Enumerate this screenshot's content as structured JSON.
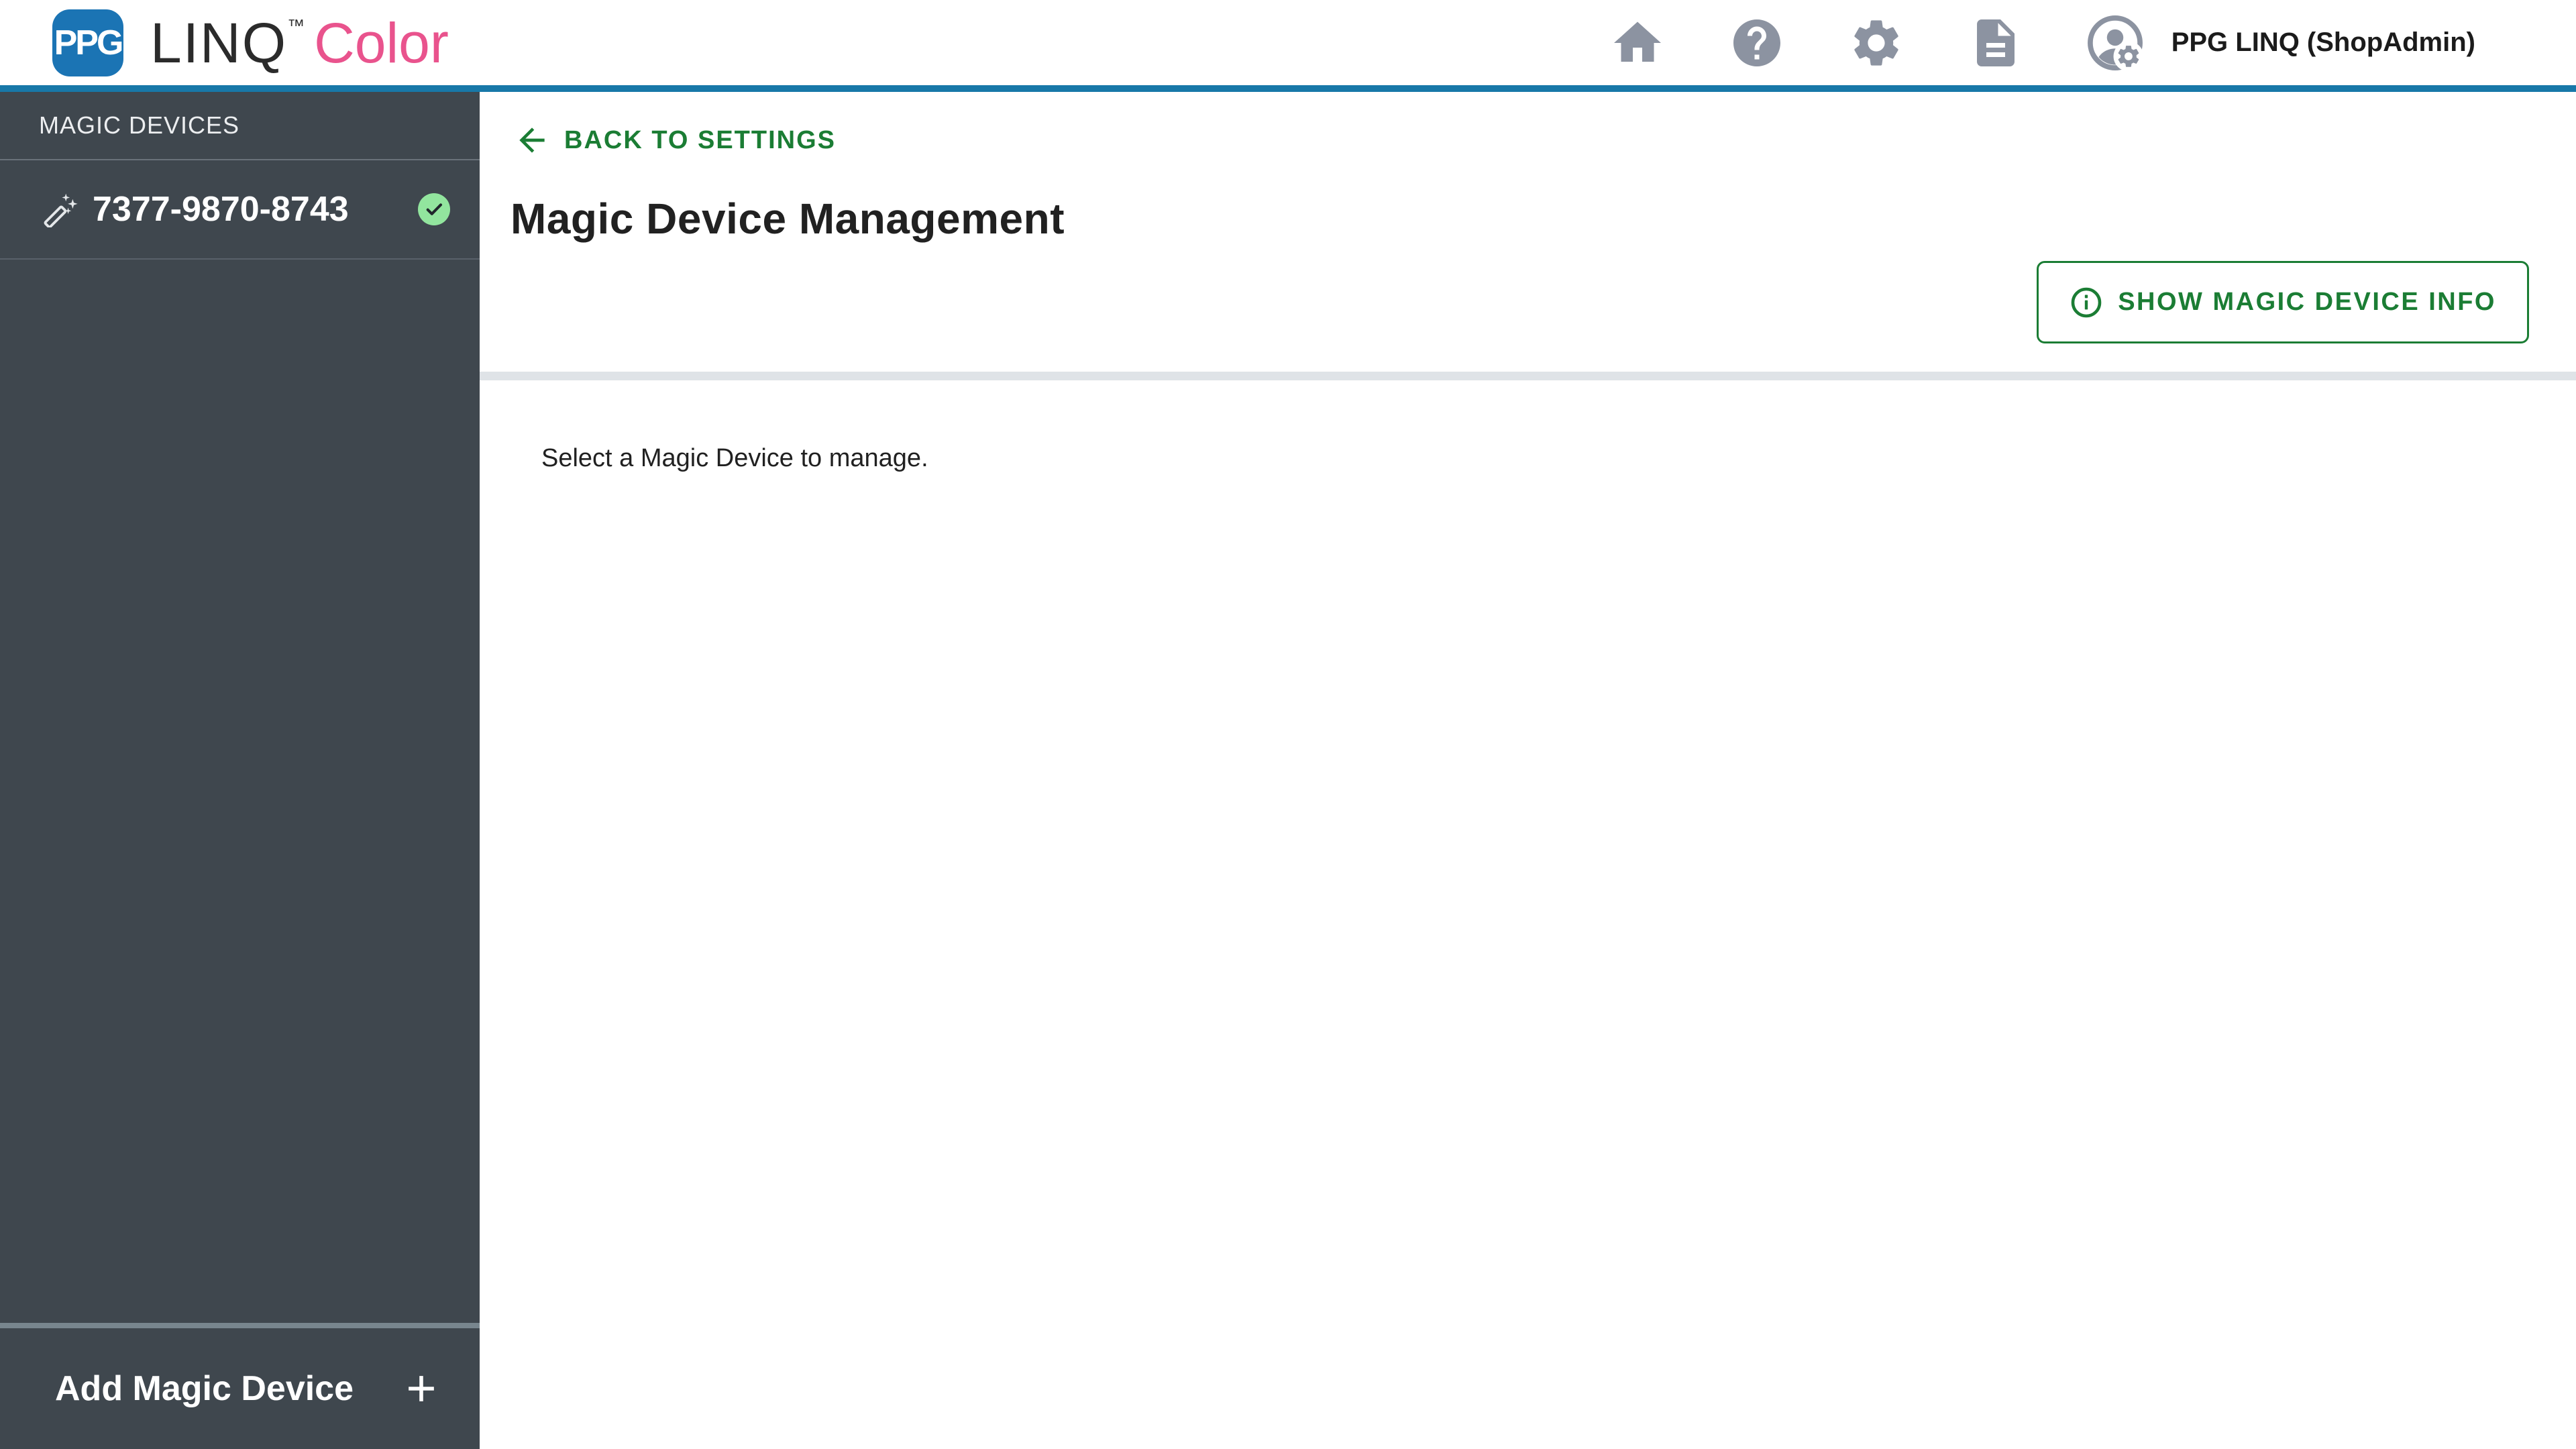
{
  "header": {
    "logo": {
      "badge_text": "PPG",
      "product_name": "LINQ",
      "trademark": "™",
      "product_suffix": "Color"
    },
    "icons": [
      "home-icon",
      "help-icon",
      "gear-icon",
      "document-icon",
      "admin-user-icon"
    ],
    "user_name": "PPG LINQ (ShopAdmin)"
  },
  "sidebar": {
    "title": "MAGIC DEVICES",
    "devices": [
      {
        "id": "7377-9870-8743",
        "icon": "magic-wand-icon",
        "status": "connected",
        "status_icon": "check-icon"
      }
    ],
    "add_button": {
      "label": "Add Magic Device",
      "icon": "plus-icon"
    }
  },
  "main": {
    "back_link": {
      "label": "BACK TO SETTINGS",
      "icon": "arrow-left-icon"
    },
    "title": "Magic Device Management",
    "info_button": {
      "label": "SHOW MAGIC DEVICE INFO",
      "icon": "info-icon"
    },
    "empty_message": "Select a Magic Device to manage."
  },
  "colors": {
    "header_accent_blue": "#1878A8",
    "brand_blue": "#1B74B4",
    "brand_pink": "#E9538D",
    "link_green": "#1B7D34",
    "sidebar_bg": "#3F474E",
    "badge_green": "#92E59E",
    "header_icon_gray": "#8C93A1",
    "divider_gray": "#DFE3E7"
  }
}
